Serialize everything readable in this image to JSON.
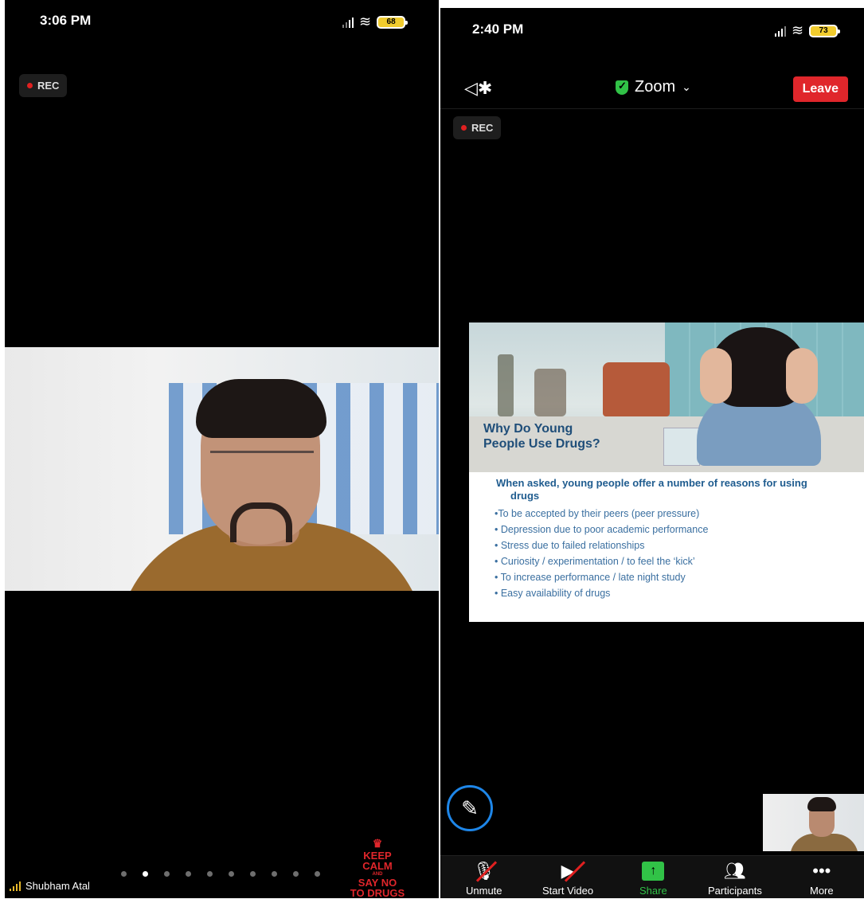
{
  "left_screen": {
    "status_time": "3:06 PM",
    "battery": "68",
    "rec_label": "REC",
    "participant_name": "Shubham Atal",
    "page_dot_count": 10,
    "active_page_dot": 1,
    "keep_calm": {
      "line1": "KEEP",
      "line2": "CALM",
      "line3": "AND",
      "line4": "SAY NO",
      "line5": "TO DRUGS"
    }
  },
  "right_screen": {
    "status_time": "2:40 PM",
    "battery": "73",
    "meeting_title": "Zoom",
    "leave_label": "Leave",
    "rec_label": "REC",
    "slide": {
      "title_line1": "Why Do Young",
      "title_line2": "People Use Drugs?",
      "heading_line1": "When asked, young people offer a number of reasons for using",
      "heading_line2": "drugs",
      "bullets": [
        "•To be accepted by their peers (peer pressure)",
        "• Depression due to poor academic performance",
        "• Stress due to failed relationships",
        "• Curiosity / experimentation  / to feel the ‘kick’",
        "• To increase performance / late night study",
        "• Easy availability of drugs"
      ]
    },
    "toolbar": {
      "unmute": "Unmute",
      "start_video": "Start Video",
      "share": "Share",
      "participants": "Participants",
      "more": "More"
    }
  },
  "colors": {
    "leave_red": "#e0262b",
    "share_green": "#31c247",
    "pencil_blue": "#1e86e8",
    "rec_red": "#e02020"
  }
}
